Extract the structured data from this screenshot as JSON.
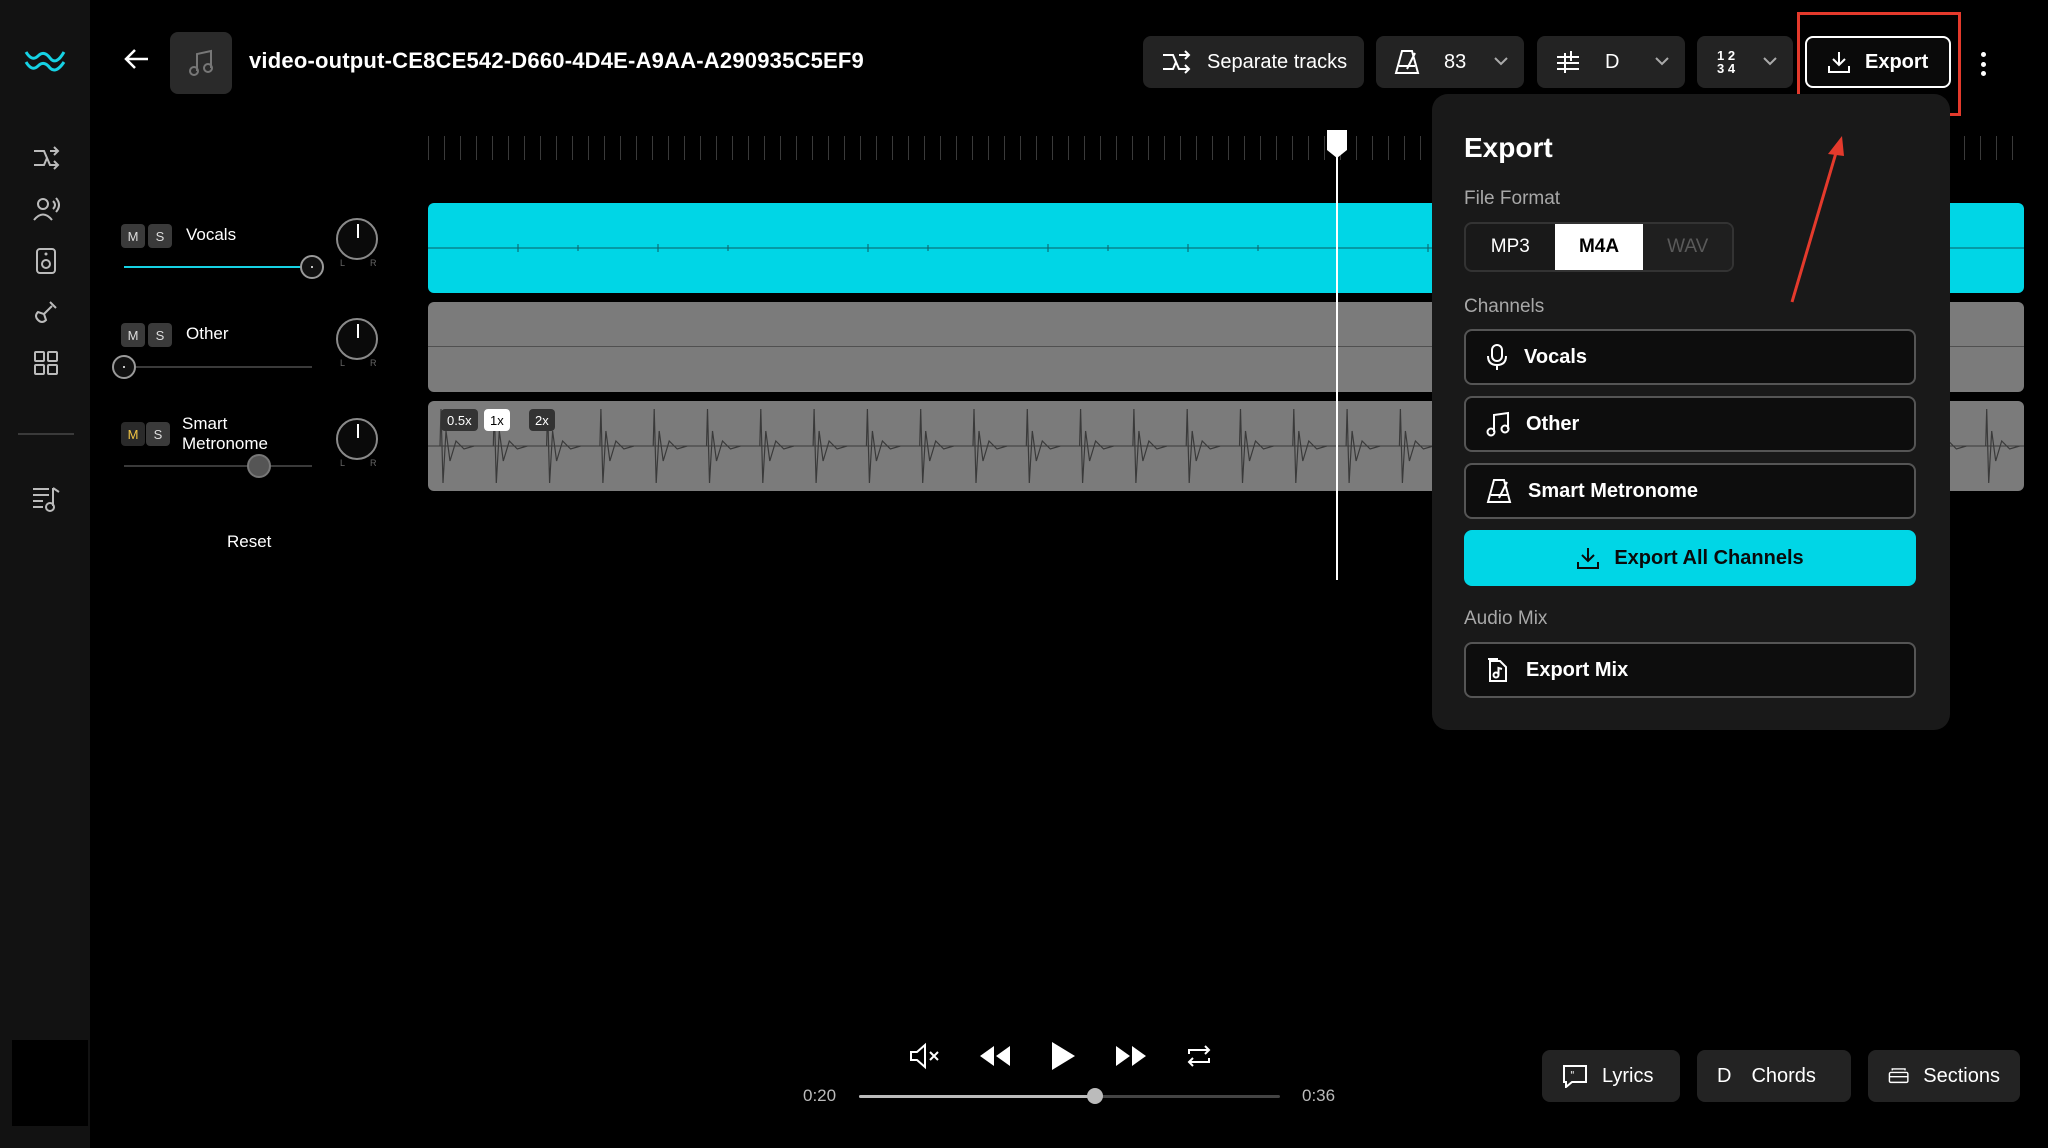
{
  "header": {
    "title": "video-output-CE8CE542-D660-4D4E-A9AA-A290935C5EF9",
    "separate_label": "Separate tracks",
    "tempo_value": "83",
    "key_value": "D",
    "time_sig_top": "1 2",
    "time_sig_bottom": "3 4",
    "export_label": "Export"
  },
  "tracks": [
    {
      "name": "Vocals",
      "mute": "M",
      "solo": "S",
      "volume": 1.0
    },
    {
      "name": "Other",
      "mute": "M",
      "solo": "S",
      "volume": 0.0
    },
    {
      "name": "Smart",
      "name2": "Metronome",
      "mute": "M",
      "solo": "S",
      "volume": 0.72
    }
  ],
  "pan_l": "L",
  "pan_r": "R",
  "reset_label": "Reset",
  "speeds": [
    "0.5x",
    "1x",
    "2x"
  ],
  "export_panel": {
    "title": "Export",
    "file_format_label": "File Format",
    "formats": [
      "MP3",
      "M4A",
      "WAV"
    ],
    "selected_format": "M4A",
    "channels_label": "Channels",
    "channels": [
      "Vocals",
      "Other",
      "Smart Metronome"
    ],
    "export_all_label": "Export All Channels",
    "audio_mix_label": "Audio Mix",
    "export_mix_label": "Export Mix"
  },
  "transport": {
    "current_time": "0:20",
    "total_time": "0:36",
    "progress": 0.56
  },
  "bottom": {
    "lyrics_label": "Lyrics",
    "chords_key": "D",
    "chords_label": "Chords",
    "sections_label": "Sections"
  },
  "colors": {
    "accent": "#00d6e6",
    "highlight": "#e43a2c"
  }
}
